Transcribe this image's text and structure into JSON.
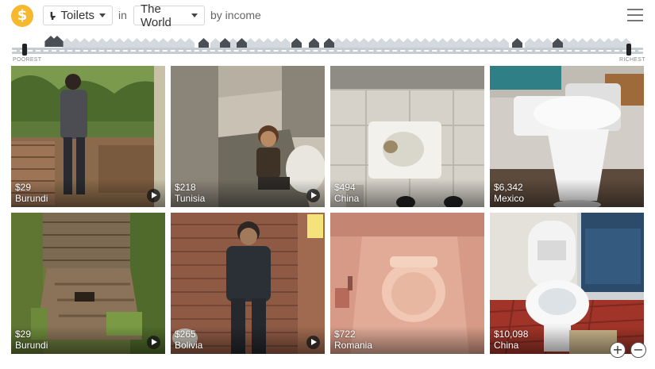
{
  "header": {
    "logo_symbol": "$",
    "topic": "Toilets",
    "in_word": "in",
    "place": "The World",
    "by_word": "by income"
  },
  "income_strip": {
    "left_label": "POOREST",
    "right_label": "RICHEST"
  },
  "cards": [
    {
      "price": "$29",
      "country": "Burundi"
    },
    {
      "price": "$218",
      "country": "Tunisia"
    },
    {
      "price": "$494",
      "country": "China"
    },
    {
      "price": "$6,342",
      "country": "Mexico"
    },
    {
      "price": "$29",
      "country": "Burundi"
    },
    {
      "price": "$265",
      "country": "Bolivia"
    },
    {
      "price": "$722",
      "country": "Romania"
    },
    {
      "price": "$10,098",
      "country": "China"
    }
  ],
  "zoom": {
    "in_symbol": "+",
    "out_symbol": "−"
  },
  "colors": {
    "accent": "#f5b82e",
    "strip": "#c6ccd2",
    "house_dark": "#4a4f55",
    "house_light": "#d4d9de"
  }
}
